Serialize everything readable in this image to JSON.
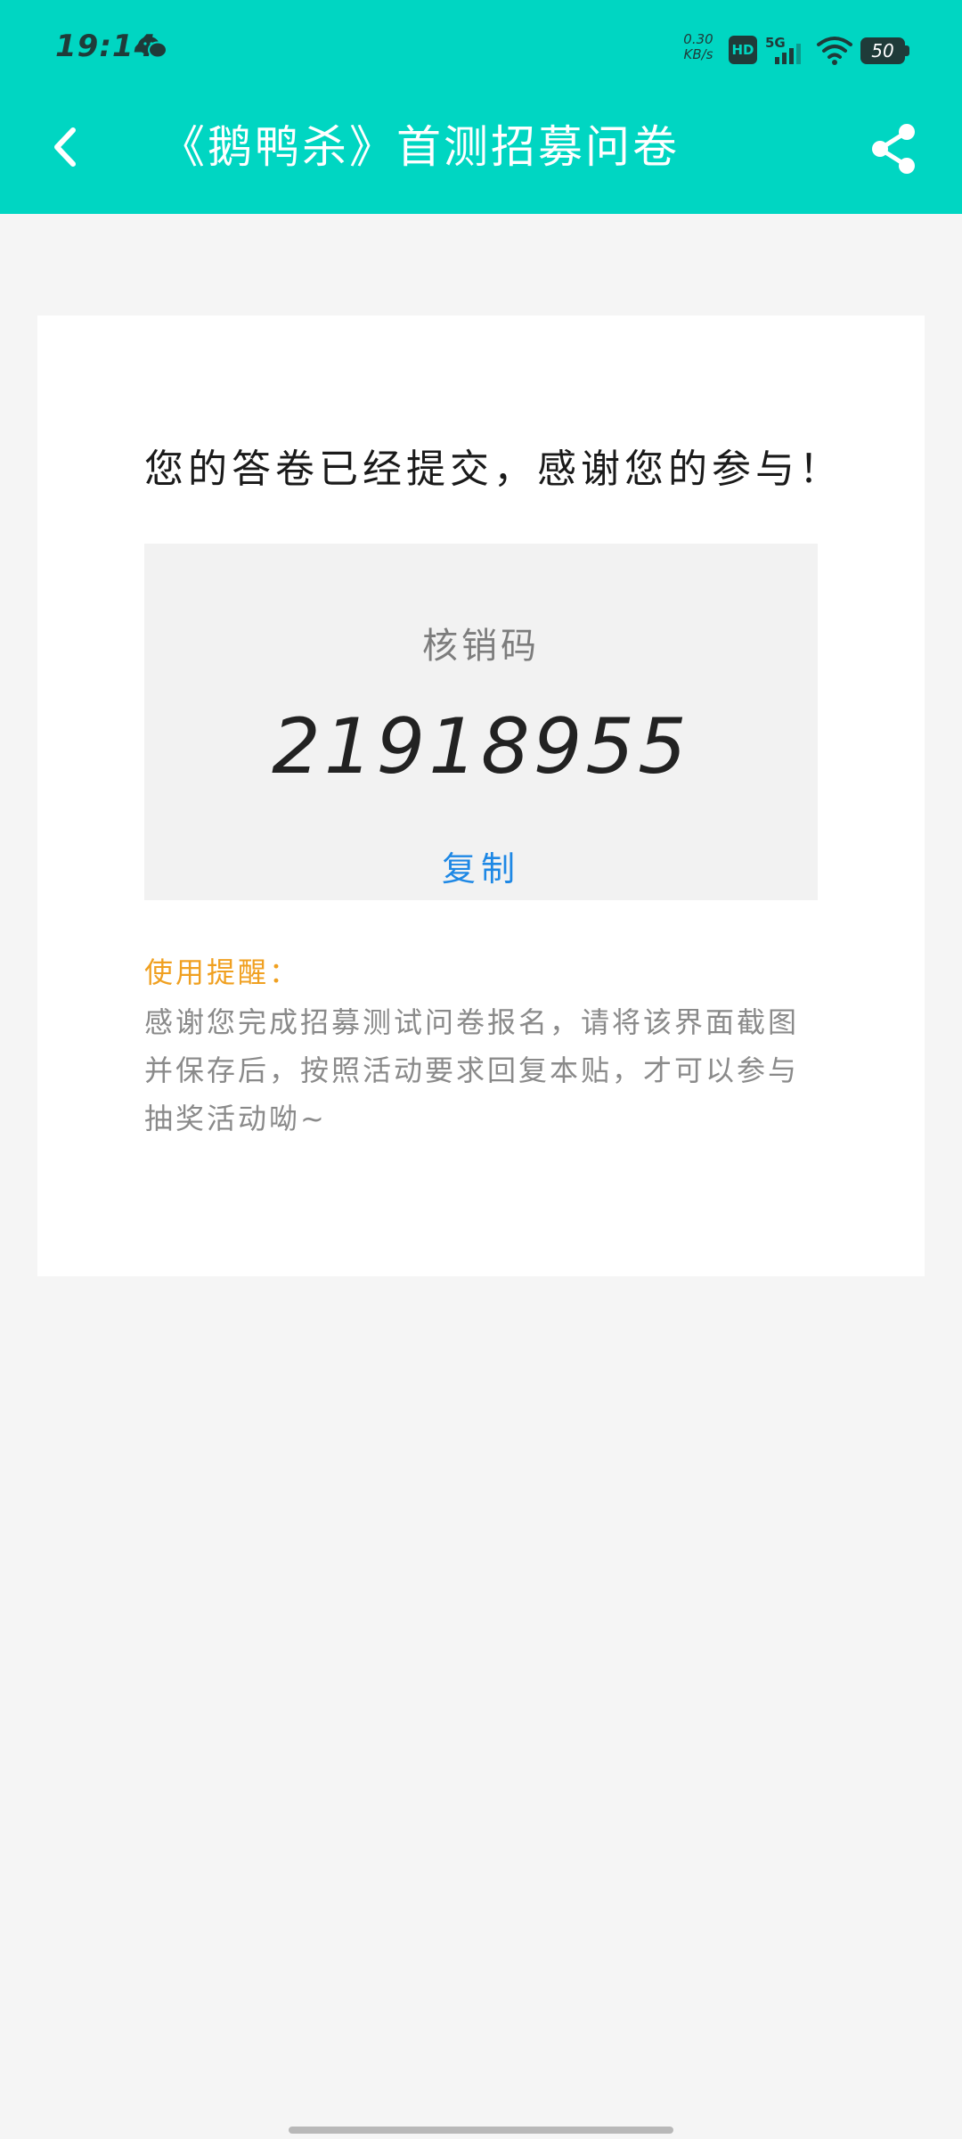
{
  "status_bar": {
    "time": "19:14",
    "net_speed_value": "0.30",
    "net_speed_unit": "KB/s",
    "hd_label": "HD",
    "network_label": "5G",
    "battery_level": "50"
  },
  "header": {
    "title": "《鹅鸭杀》首测招募问卷",
    "background_color": "#00d6c2"
  },
  "icons": {
    "back": "back-chevron-icon",
    "share": "share-icon",
    "wechat": "wechat-icon",
    "wifi": "wifi-icon",
    "signal": "signal-icon",
    "battery": "battery-icon"
  },
  "main": {
    "submitted_message": "您的答卷已经提交，感谢您的参与！",
    "code_label": "核销码",
    "code_value": "21918955",
    "copy_label": "复制",
    "tip_title": "使用提醒：",
    "tip_text": "感谢您完成招募测试问卷报名，请将该界面截图并保存后，按照活动要求回复本贴，才可以参与抽奖活动呦~"
  },
  "colors": {
    "accent": "#00d6c2",
    "copy_link": "#1e88e5",
    "tip_title": "#f0a020"
  }
}
